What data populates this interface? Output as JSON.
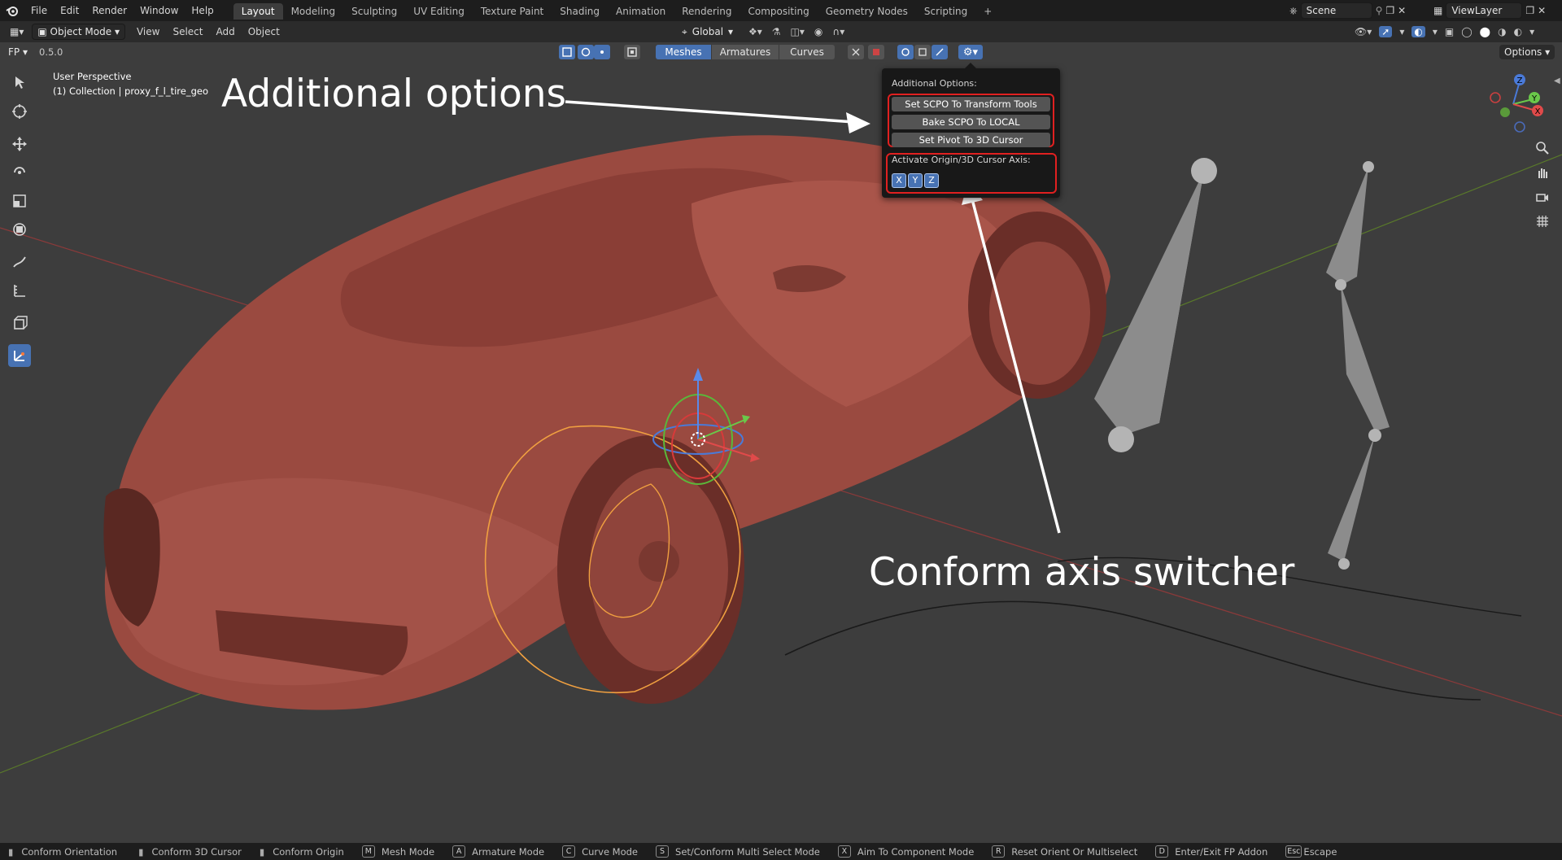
{
  "topbar": {
    "menus": [
      "File",
      "Edit",
      "Render",
      "Window",
      "Help"
    ],
    "workspaces": [
      "Layout",
      "Modeling",
      "Sculpting",
      "UV Editing",
      "Texture Paint",
      "Shading",
      "Animation",
      "Rendering",
      "Compositing",
      "Geometry Nodes",
      "Scripting"
    ],
    "active_workspace": "Layout",
    "add_tab": "+",
    "scene_name": "Scene",
    "view_layer_name": "ViewLayer"
  },
  "header": {
    "mode": "Object Mode",
    "menus": [
      "View",
      "Select",
      "Add",
      "Object"
    ],
    "orientation": "Global",
    "options": "Options"
  },
  "tool_header": {
    "addon_label": "FP",
    "value": "0.5.0",
    "modes": [
      "Meshes",
      "Armatures",
      "Curves"
    ],
    "active_mode": "Meshes"
  },
  "viewport": {
    "perspective": "User Perspective",
    "collection": "(1) Collection | proxy_f_l_tire_geo",
    "gizmo_axes": [
      "X",
      "Y",
      "Z"
    ]
  },
  "popup": {
    "title": "Additional Options:",
    "buttons": [
      "Set SCPO To Transform Tools",
      "Bake SCPO To LOCAL",
      "Set Pivot To 3D Cursor"
    ],
    "axis_label": "Activate Origin/3D Cursor Axis:",
    "axis_buttons": [
      "X",
      "Y",
      "Z"
    ]
  },
  "annotations": {
    "additional": "Additional options",
    "conform": "Conform axis switcher"
  },
  "statusbar": [
    {
      "key": "",
      "label": "Conform Orientation"
    },
    {
      "key": "",
      "label": "Conform 3D Cursor"
    },
    {
      "key": "",
      "label": "Conform Origin"
    },
    {
      "key": "M",
      "label": "Mesh Mode"
    },
    {
      "key": "A",
      "label": "Armature Mode"
    },
    {
      "key": "C",
      "label": "Curve Mode"
    },
    {
      "key": "S",
      "label": "Set/Conform Multi Select Mode"
    },
    {
      "key": "X",
      "label": "Aim To Component Mode"
    },
    {
      "key": "R",
      "label": "Reset Orient Or Multiselect"
    },
    {
      "key": "D",
      "label": "Enter/Exit FP Addon"
    },
    {
      "key": "Esc",
      "label": "Escape"
    }
  ],
  "colors": {
    "accent": "#4772b3",
    "highlight": "#e02020",
    "car": "#9a4a40",
    "selection": "#f0a040"
  }
}
